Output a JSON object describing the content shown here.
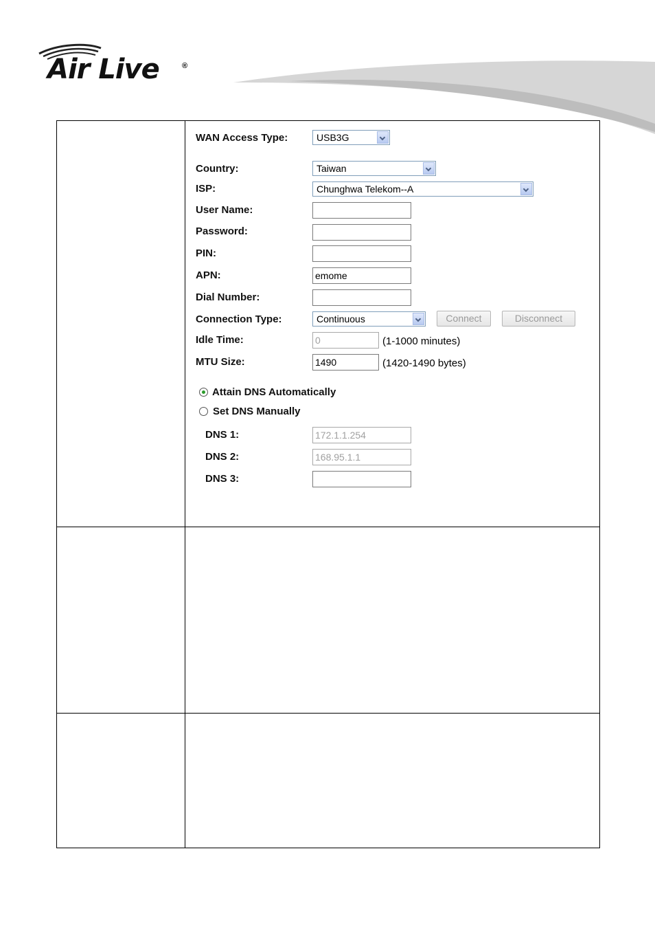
{
  "brand": {
    "name": "Air Live",
    "reg_mark": "®"
  },
  "form": {
    "wan_access_type": {
      "label": "WAN Access Type:",
      "value": "USB3G"
    },
    "country": {
      "label": "Country:",
      "value": "Taiwan"
    },
    "isp": {
      "label": "ISP:",
      "value": "Chunghwa Telekom--A"
    },
    "user_name": {
      "label": "User Name:",
      "value": ""
    },
    "password": {
      "label": "Password:",
      "value": ""
    },
    "pin": {
      "label": "PIN:",
      "value": ""
    },
    "apn": {
      "label": "APN:",
      "value": "emome"
    },
    "dial_number": {
      "label": "Dial Number:",
      "value": ""
    },
    "connection_type": {
      "label": "Connection Type:",
      "value": "Continuous"
    },
    "connect_label": "Connect",
    "disconnect_label": "Disconnect",
    "idle_time": {
      "label": "Idle Time:",
      "value": "0",
      "hint": "(1-1000 minutes)"
    },
    "mtu_size": {
      "label": "MTU Size:",
      "value": "1490",
      "hint": "(1420-1490 bytes)"
    },
    "dns_auto_label": "Attain DNS Automatically",
    "dns_manual_label": "Set DNS Manually",
    "dns_mode": "auto",
    "dns1": {
      "label": "DNS 1:",
      "value": "172.1.1.254"
    },
    "dns2": {
      "label": "DNS 2:",
      "value": "168.95.1.1"
    },
    "dns3": {
      "label": "DNS 3:",
      "value": ""
    }
  },
  "colors": {
    "selected_radio": "#2a9b2a",
    "disabled_text": "#a0a0a0"
  }
}
